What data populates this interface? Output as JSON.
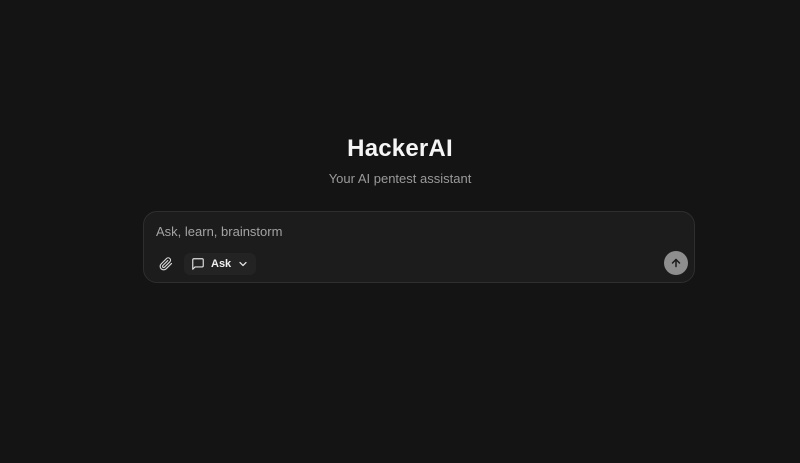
{
  "hero": {
    "title": "HackerAI",
    "subtitle": "Your AI pentest assistant"
  },
  "composer": {
    "placeholder": "Ask, learn, brainstorm",
    "value": "",
    "attach_icon": "paperclip-icon",
    "mode": {
      "icon": "message-square-icon",
      "label": "Ask",
      "chevron_icon": "chevron-down-icon"
    },
    "send_icon": "arrow-up-icon"
  },
  "colors": {
    "background": "#141414",
    "composer_bg": "#1c1c1c",
    "composer_border": "#2e2e2e",
    "title": "#f5f5f5",
    "subtitle": "#9a9a9a",
    "send_button": "#8e8e8e"
  }
}
